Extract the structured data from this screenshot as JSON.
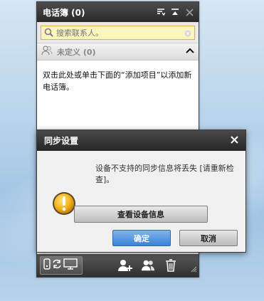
{
  "phonebook": {
    "title": "电话簿 (0)",
    "search_placeholder": "搜索联系人。",
    "group_label": "未定义 (0)",
    "hint": "双击此处或单击下面的“添加项目”以添加新电话簿。"
  },
  "dialog": {
    "title": "同步设置",
    "message": "设备不支持的同步信息将丢失 [请重新检查]。",
    "view_info_label": "查看设备信息",
    "ok_label": "确定",
    "cancel_label": "取消"
  },
  "icons": {
    "sort": "sort-icon",
    "collapse": "collapse-top-icon",
    "close": "close-icon",
    "search": "search-icon",
    "clear": "clear-icon",
    "group": "contacts-group-icon",
    "chevron": "chevron-up-icon",
    "warning": "warning-icon",
    "sync": "phone-sync-pc-icon",
    "add_contact": "add-contact-icon",
    "add_group": "add-group-icon",
    "delete": "trash-icon"
  },
  "colors": {
    "search_bg": "#fbf6bd",
    "ok_button": "#3c82d6",
    "header_dark": "#2a2a2a",
    "warning": "#e8a300"
  }
}
